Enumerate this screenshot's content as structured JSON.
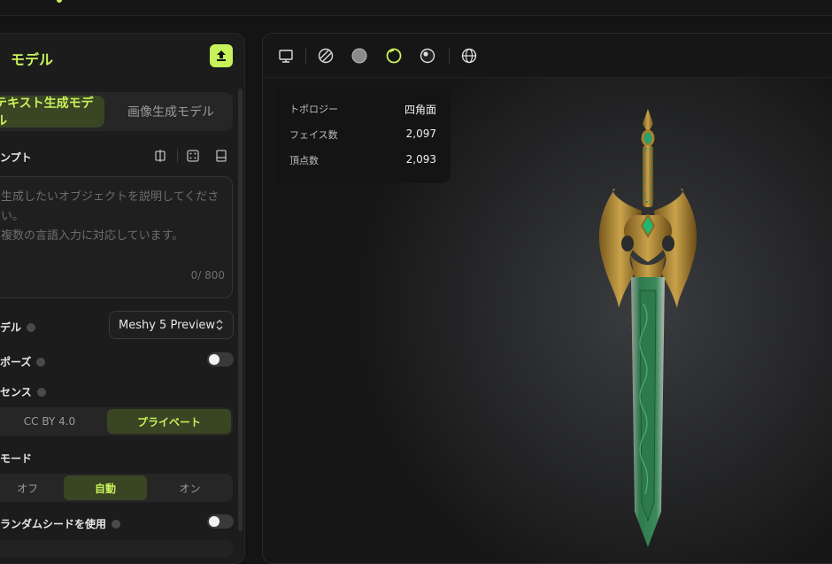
{
  "panel": {
    "title": "モデル",
    "tabs": {
      "text_model": "テキスト生成モデル",
      "image_model": "画像生成モデル"
    },
    "prompt": {
      "label": "ンプト",
      "placeholder_line1": "生成したいオブジェクトを説明してください。",
      "placeholder_line2": "複数の言語入力に対応しています。",
      "counter": "0/ 800"
    },
    "model": {
      "label": "デル",
      "value": "Meshy 5 Preview"
    },
    "pose": {
      "label": "ポーズ",
      "enabled": false
    },
    "license": {
      "label": "センス",
      "options": [
        "CC BY 4.0",
        "プライベート"
      ],
      "selected": "プライベート"
    },
    "mode": {
      "label": "モード",
      "options": [
        "オフ",
        "自動",
        "オン"
      ],
      "selected": "自動"
    },
    "random_seed": {
      "label": "ランダムシードを使用",
      "enabled": false
    }
  },
  "viewer": {
    "toolbar_icons": [
      "monitor-icon",
      "wireframe-sphere-icon",
      "solid-sphere-icon",
      "outline-sphere-icon",
      "shaded-sphere-icon",
      "globe-grid-icon"
    ],
    "active_icon": "outline-sphere-icon",
    "stats": [
      {
        "key": "トポロジー",
        "value": "四角面"
      },
      {
        "key": "フェイス数",
        "value": "2,097"
      },
      {
        "key": "頂点数",
        "value": "2,093"
      }
    ]
  },
  "colors": {
    "accent": "#c8f25a",
    "accent_bg": "#3a4524",
    "panel_bg": "#1c1c1c"
  }
}
